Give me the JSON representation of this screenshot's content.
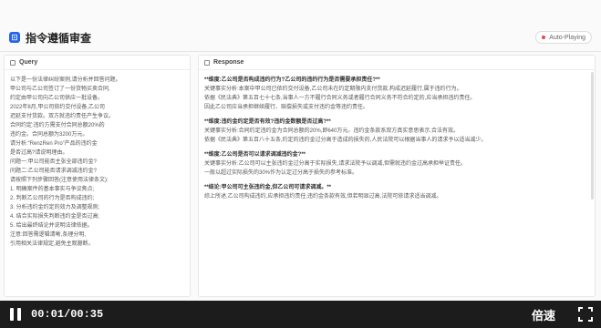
{
  "header": {
    "title": "指令遵循审查",
    "autoplay_label": "Auto-Playing"
  },
  "query": {
    "label": "Query",
    "lines": [
      "以下是一份法律纠纷案例,请分析并回答问题。",
      "甲公司与乙公司签订了一份货物买卖合同,",
      "约定由甲公司向乙公司供应一批设备。",
      "2022年8月,甲公司依约交付设备,乙公司",
      "迟延支付货款。双方就违约责任产生争议。",
      "合同约定:违约方需支付合同总额20%的",
      "违约金。合同总额为3200万元。",
      "请分析:“RenzRen Pro”产品的违约金",
      "是否过高?请说明理由。",
      "问题一:甲公司能否主张全部违约金?",
      "问题二:乙公司能否请求调减违约金?",
      "请按照下列步骤回答(注意使用法律条文):",
      "1. 明确案件的基本事实与争议焦点;",
      "2. 判断乙公司的行为是否构成违约;",
      "3. 分析违约金约定的效力及调整规则;",
      "4. 结合实际损失判断违约金是否过高;",
      "5. 给出最终结论并说明法律依据。",
      "注意:回答需逻辑清晰,条理分明,",
      "引用相关法律规定,避免主观臆断。"
    ]
  },
  "response": {
    "label": "Response",
    "blocks": [
      {
        "heading": "**维度:乙公司是否构成违约行为?乙公司的违约行为是否需要承担责任?**",
        "lines": [
          "关键事实分析:本案中甲公司已依约交付设备,乙公司未在约定期限内支付货款,构成迟延履行,属于违约行为。",
          "依据《民法典》第五百七十七条,当事人一方不履行合同义务或者履行合同义务不符合约定的,应当承担违约责任。",
          "因此乙公司应当承担继续履行、赔偿损失或支付违约金等违约责任。"
        ]
      },
      {
        "heading": "**维度:违约金约定是否有效?违约金数额是否过高?**",
        "lines": [
          "关键事实分析:合同约定违约金为合同总额的20%,即640万元。违约金条款系双方真实意思表示,合法有效。",
          "依据《民法典》第五百八十五条,约定的违约金过分高于造成的损失的,人民法院可以根据当事人的请求予以适当减少。"
        ]
      },
      {
        "heading": "**维度:乙公司是否可以请求调减违约金?**",
        "lines": [
          "关键事实分析:乙公司可以主张违约金过分高于实际损失,请求法院予以调减,但需就违约金过高承担举证责任。",
          "一般以超过实际损失的30%作为认定过分高于损失的参考标准。"
        ]
      },
      {
        "heading": "**结论:甲公司可主张违约金,但乙公司可请求调减。**",
        "lines": [
          "综上所述,乙公司构成违约,应承担违约责任;违约金条款有效,但若明显过高,法院可依请求适当调减。"
        ]
      }
    ]
  },
  "player": {
    "time": "00:01/00:35",
    "speed_label": "倍速"
  },
  "colors": {
    "accent": "#2563eb",
    "autoplay_dot": "#ef4444",
    "controls_bg": "#1c1c1c"
  },
  "icons": {
    "logo": "document-icon",
    "play": "pause-icon",
    "fullscreen": "fullscreen-icon"
  }
}
